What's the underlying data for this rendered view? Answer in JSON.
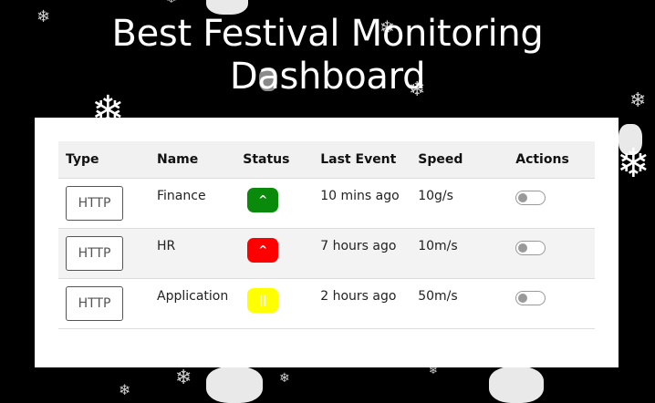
{
  "header": {
    "title_line1": "Best Festival Monitoring",
    "title_line2": "Dashboard"
  },
  "table": {
    "columns": [
      "Type",
      "Name",
      "Status",
      "Last Event",
      "Speed",
      "Actions"
    ],
    "rows": [
      {
        "type": "HTTP",
        "name": "Finance",
        "status_symbol": "^",
        "status_color": "#0a8a0a",
        "status_text_color": "#ffffff",
        "last_event": "10 mins ago",
        "speed": "10g/s"
      },
      {
        "type": "HTTP",
        "name": "HR",
        "status_symbol": "^",
        "status_color": "#ff0000",
        "status_text_color": "#ffffff",
        "last_event": "7 hours ago",
        "speed": "10m/s"
      },
      {
        "type": "HTTP",
        "name": "Application",
        "status_symbol": "||",
        "status_color": "#ffff00",
        "status_text_color": "#ffffff",
        "last_event": "2 hours ago",
        "speed": "50m/s"
      }
    ]
  },
  "decor": {
    "snowflake_icon": "❄"
  }
}
